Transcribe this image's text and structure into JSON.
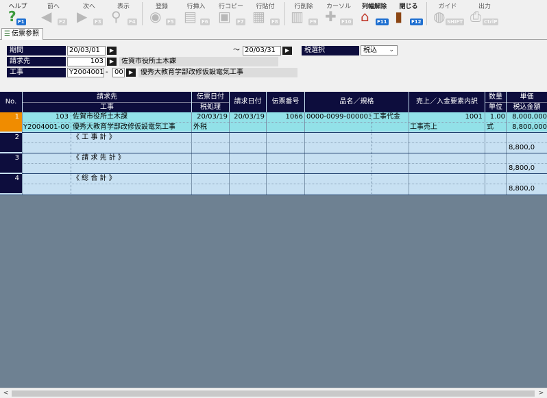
{
  "toolbar": {
    "buttons": [
      {
        "label": "ヘルプ",
        "key": "F1",
        "icon": "help-icon",
        "enabled": true
      },
      {
        "label": "前へ",
        "key": "F2",
        "icon": "arrow-left-icon",
        "enabled": false
      },
      {
        "label": "次へ",
        "key": "F3",
        "icon": "arrow-right-icon",
        "enabled": false
      },
      {
        "label": "表示",
        "key": "F4",
        "icon": "search-icon",
        "enabled": false
      },
      {
        "label": "登録",
        "key": "F5",
        "icon": "register-icon",
        "enabled": false
      },
      {
        "label": "行挿入",
        "key": "F6",
        "icon": "insert-row-icon",
        "enabled": false
      },
      {
        "label": "行コピー",
        "key": "F7",
        "icon": "copy-row-icon",
        "enabled": false
      },
      {
        "label": "行貼付",
        "key": "F8",
        "icon": "paste-row-icon",
        "enabled": false
      },
      {
        "label": "行削除",
        "key": "F9",
        "icon": "delete-row-icon",
        "enabled": false
      },
      {
        "label": "カーソル",
        "key": "F10",
        "icon": "cursor-icon",
        "enabled": false
      },
      {
        "label": "列幅解除",
        "key": "F11",
        "icon": "column-width-icon",
        "enabled": true
      },
      {
        "label": "閉じる",
        "key": "F12",
        "icon": "close-door-icon",
        "enabled": true
      },
      {
        "label": "ガイド",
        "key": "SHIFT",
        "icon": "guide-bulb-icon",
        "enabled": false
      },
      {
        "label": "出力",
        "key": "CtrlP",
        "icon": "print-icon",
        "enabled": false
      }
    ]
  },
  "tab": {
    "label": "伝票参照",
    "icon": "document-icon"
  },
  "form": {
    "period_label": "期間",
    "period_from": "20/03/01",
    "tilde": "～",
    "period_to": "20/03/31",
    "tax_label": "税選択",
    "tax_value": "税込",
    "customer_label": "請求先",
    "customer_code": "103",
    "customer_name": "佐賀市役所土木課",
    "project_label": "工事",
    "project_code": "Y2004001",
    "dash": "-",
    "project_branch": "00",
    "project_name": "優秀大教育学部改修仮設電気工事"
  },
  "grid": {
    "headers": {
      "no": "No.",
      "customer": "請求先",
      "project": "工事",
      "slip_date": "伝票日付",
      "tax_proc": "税処理",
      "bill_date": "請求日付",
      "slip_no": "伝票番号",
      "item": "品名／規格",
      "sales": "売上／入金要素内訳",
      "qty": "数量",
      "unit": "単位",
      "price": "単価",
      "amount": "税込金額"
    },
    "rows": [
      {
        "no": "1",
        "customer_code": "103",
        "customer_name": "佐賀市役所土木課",
        "project_code": "Y2004001-00",
        "project_name": "優秀大教育学部改修仮設電気工事",
        "slip_date": "20/03/19",
        "tax_proc": "外税",
        "bill_date": "20/03/19",
        "slip_no": "1066",
        "item_code": "0000-0099-000003",
        "item_name": "工事代金",
        "sales_code": "1001",
        "sales_name": "工事売上",
        "qty": "1.00",
        "unit": "式",
        "price": "8,000,000",
        "amount": "8,800,000"
      },
      {
        "no": "2",
        "label": "《 工 事 計 》",
        "amount": "8,800,0"
      },
      {
        "no": "3",
        "label": "《 請 求 先 計 》",
        "amount": "8,800,0"
      },
      {
        "no": "4",
        "label": "《 総 合 計 》",
        "amount": "8,800,0"
      }
    ]
  },
  "scrollbar": {
    "left": "<",
    "right": ">"
  }
}
